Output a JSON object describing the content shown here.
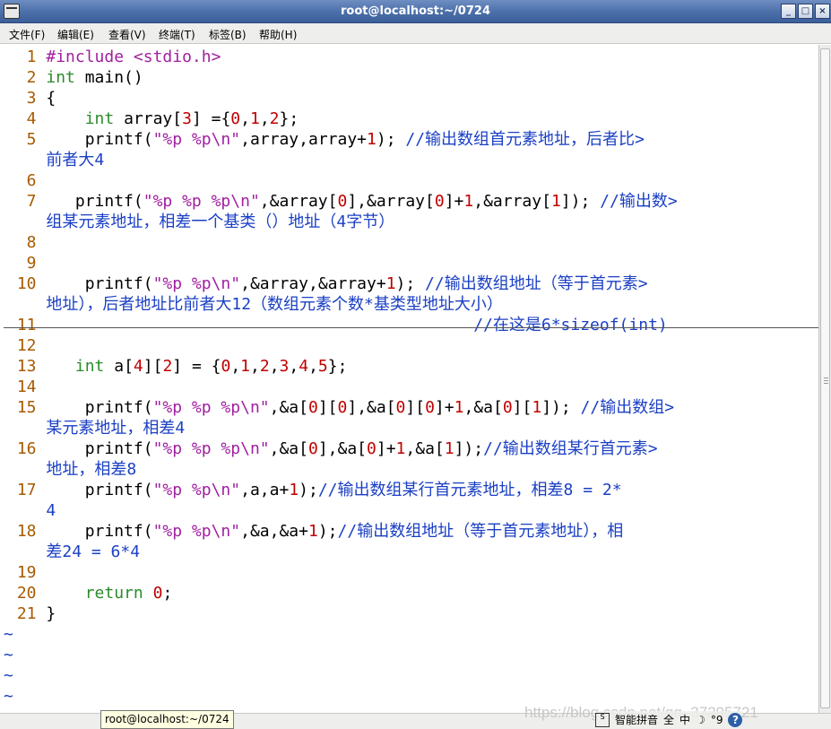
{
  "window": {
    "title": "root@localhost:~/0724",
    "minimize": "_",
    "maximize": "□",
    "close": "×"
  },
  "menu": [
    "文件(F)",
    "编辑(E)",
    "查看(V)",
    "终端(T)",
    "标签(B)",
    "帮助(H)"
  ],
  "editor": {
    "lines": [
      [
        [
          "ln",
          "  1 "
        ],
        [
          "pp",
          "#include <stdio.h>"
        ]
      ],
      [
        [
          "ln",
          "  2 "
        ],
        [
          "kw",
          "int"
        ],
        [
          "tx",
          " main()"
        ]
      ],
      [
        [
          "ln",
          "  3 "
        ],
        [
          "tx",
          "{"
        ]
      ],
      [
        [
          "ln",
          "  4 "
        ],
        [
          "tx",
          "    "
        ],
        [
          "kw",
          "int"
        ],
        [
          "tx",
          " array["
        ],
        [
          "num",
          "3"
        ],
        [
          "tx",
          "] ={"
        ],
        [
          "num",
          "0"
        ],
        [
          "tx",
          ","
        ],
        [
          "num",
          "1"
        ],
        [
          "tx",
          ","
        ],
        [
          "num",
          "2"
        ],
        [
          "tx",
          "};"
        ]
      ],
      [
        [
          "ln",
          "  5 "
        ],
        [
          "tx",
          "    printf("
        ],
        [
          "str",
          "\"%p %p\\n\""
        ],
        [
          "tx",
          ",array,array+"
        ],
        [
          "num",
          "1"
        ],
        [
          "tx",
          "); "
        ],
        [
          "cm",
          "//输出数组首元素地址，后者比"
        ],
        [
          "cm",
          ">"
        ]
      ],
      [
        [
          "tx",
          "    "
        ],
        [
          "cm",
          "前者大4"
        ]
      ],
      [
        [
          "ln",
          "  6 "
        ]
      ],
      [
        [
          "ln",
          "  7 "
        ],
        [
          "tx",
          "   printf("
        ],
        [
          "str",
          "\"%p %p %p\\n\""
        ],
        [
          "tx",
          ",&array["
        ],
        [
          "num",
          "0"
        ],
        [
          "tx",
          "],&array["
        ],
        [
          "num",
          "0"
        ],
        [
          "tx",
          "]+"
        ],
        [
          "num",
          "1"
        ],
        [
          "tx",
          ",&array["
        ],
        [
          "num",
          "1"
        ],
        [
          "tx",
          "]); "
        ],
        [
          "cm",
          "//输出数"
        ],
        [
          "cm",
          ">"
        ]
      ],
      [
        [
          "tx",
          "    "
        ],
        [
          "cm",
          "组某元素地址，相差一个基类（）地址（4字节）"
        ]
      ],
      [
        [
          "ln",
          "  8 "
        ]
      ],
      [
        [
          "ln",
          "  9 "
        ]
      ],
      [
        [
          "ln",
          " 10 "
        ],
        [
          "tx",
          "    printf("
        ],
        [
          "str",
          "\"%p %p\\n\""
        ],
        [
          "tx",
          ",&array,&array+"
        ],
        [
          "num",
          "1"
        ],
        [
          "tx",
          "); "
        ],
        [
          "cm",
          "//输出数组地址（等于首元素"
        ],
        [
          "cm",
          ">"
        ]
      ],
      [
        [
          "tx",
          "    "
        ],
        [
          "cm",
          "地址），后者地址比前者大12（数组元素个数*基类型地址大小）"
        ]
      ],
      [
        [
          "ln",
          " 11 "
        ],
        [
          "tx",
          "                                            "
        ],
        [
          "cm",
          "//在这是6*sizeof(int)"
        ]
      ],
      [
        [
          "ln",
          " 12 "
        ]
      ],
      [
        [
          "ln",
          " 13 "
        ],
        [
          "tx",
          "   "
        ],
        [
          "kw",
          "int"
        ],
        [
          "tx",
          " a["
        ],
        [
          "num",
          "4"
        ],
        [
          "tx",
          "]["
        ],
        [
          "num",
          "2"
        ],
        [
          "tx",
          "] = {"
        ],
        [
          "num",
          "0"
        ],
        [
          "tx",
          ","
        ],
        [
          "num",
          "1"
        ],
        [
          "tx",
          ","
        ],
        [
          "num",
          "2"
        ],
        [
          "tx",
          ","
        ],
        [
          "num",
          "3"
        ],
        [
          "tx",
          ","
        ],
        [
          "num",
          "4"
        ],
        [
          "tx",
          ","
        ],
        [
          "num",
          "5"
        ],
        [
          "tx",
          "};"
        ]
      ],
      [
        [
          "ln",
          " 14 "
        ]
      ],
      [
        [
          "ln",
          " 15 "
        ],
        [
          "tx",
          "    printf("
        ],
        [
          "str",
          "\"%p %p %p\\n\""
        ],
        [
          "tx",
          ",&a["
        ],
        [
          "num",
          "0"
        ],
        [
          "tx",
          "]["
        ],
        [
          "num",
          "0"
        ],
        [
          "tx",
          "],&a["
        ],
        [
          "num",
          "0"
        ],
        [
          "tx",
          "]["
        ],
        [
          "num",
          "0"
        ],
        [
          "tx",
          "]+"
        ],
        [
          "num",
          "1"
        ],
        [
          "tx",
          ",&a["
        ],
        [
          "num",
          "0"
        ],
        [
          "tx",
          "]["
        ],
        [
          "num",
          "1"
        ],
        [
          "tx",
          "]); "
        ],
        [
          "cm",
          "//输出数组"
        ],
        [
          "cm",
          ">"
        ]
      ],
      [
        [
          "tx",
          "    "
        ],
        [
          "cm",
          "某元素地址，相差4"
        ]
      ],
      [
        [
          "ln",
          " 16 "
        ],
        [
          "tx",
          "    printf("
        ],
        [
          "str",
          "\"%p %p %p\\n\""
        ],
        [
          "tx",
          ",&a["
        ],
        [
          "num",
          "0"
        ],
        [
          "tx",
          "],&a["
        ],
        [
          "num",
          "0"
        ],
        [
          "tx",
          "]+"
        ],
        [
          "num",
          "1"
        ],
        [
          "tx",
          ",&a["
        ],
        [
          "num",
          "1"
        ],
        [
          "tx",
          "]);"
        ],
        [
          "cm",
          "//输出数组某行首元素"
        ],
        [
          "cm",
          ">"
        ]
      ],
      [
        [
          "tx",
          "    "
        ],
        [
          "cm",
          "地址，相差8"
        ]
      ],
      [
        [
          "ln",
          " 17 "
        ],
        [
          "tx",
          "    printf("
        ],
        [
          "str",
          "\"%p %p\\n\""
        ],
        [
          "tx",
          ",a,a+"
        ],
        [
          "num",
          "1"
        ],
        [
          "tx",
          ");"
        ],
        [
          "cm",
          "//输出数组某行首元素地址，相差8 = 2*"
        ]
      ],
      [
        [
          "tx",
          "    "
        ],
        [
          "cm",
          "4"
        ]
      ],
      [
        [
          "ln",
          " 18 "
        ],
        [
          "tx",
          "    printf("
        ],
        [
          "str",
          "\"%p %p\\n\""
        ],
        [
          "tx",
          ",&a,&a+"
        ],
        [
          "num",
          "1"
        ],
        [
          "tx",
          ");"
        ],
        [
          "cm",
          "//输出数组地址（等于首元素地址），相"
        ]
      ],
      [
        [
          "tx",
          "    "
        ],
        [
          "cm",
          "差24 = 6*4"
        ]
      ],
      [
        [
          "ln",
          " 19 "
        ]
      ],
      [
        [
          "ln",
          " 20 "
        ],
        [
          "tx",
          "    "
        ],
        [
          "kw",
          "return"
        ],
        [
          "tx",
          " "
        ],
        [
          "num",
          "0"
        ],
        [
          "tx",
          ";"
        ]
      ],
      [
        [
          "ln",
          " 21 "
        ],
        [
          "tx",
          "}"
        ]
      ],
      [
        [
          "tl",
          "~"
        ]
      ],
      [
        [
          "tl",
          "~"
        ]
      ],
      [
        [
          "tl",
          "~"
        ]
      ],
      [
        [
          "tl",
          "~"
        ]
      ]
    ]
  },
  "tooltip": "root@localhost:~/0724",
  "watermark": "https://blog.csdn.net/qq_37295721",
  "ime": {
    "logo": "S",
    "label": "智能拼音",
    "full": "全",
    "lang": "中",
    "moon": "☽",
    "punct": "°9",
    "help": "?"
  },
  "colors": {
    "titlebar": "#4a6ea8",
    "line_number": "#a85a00",
    "keyword": "#2a8c2a",
    "string": "#a020a0",
    "number": "#c00000",
    "comment": "#1a3fc4"
  }
}
